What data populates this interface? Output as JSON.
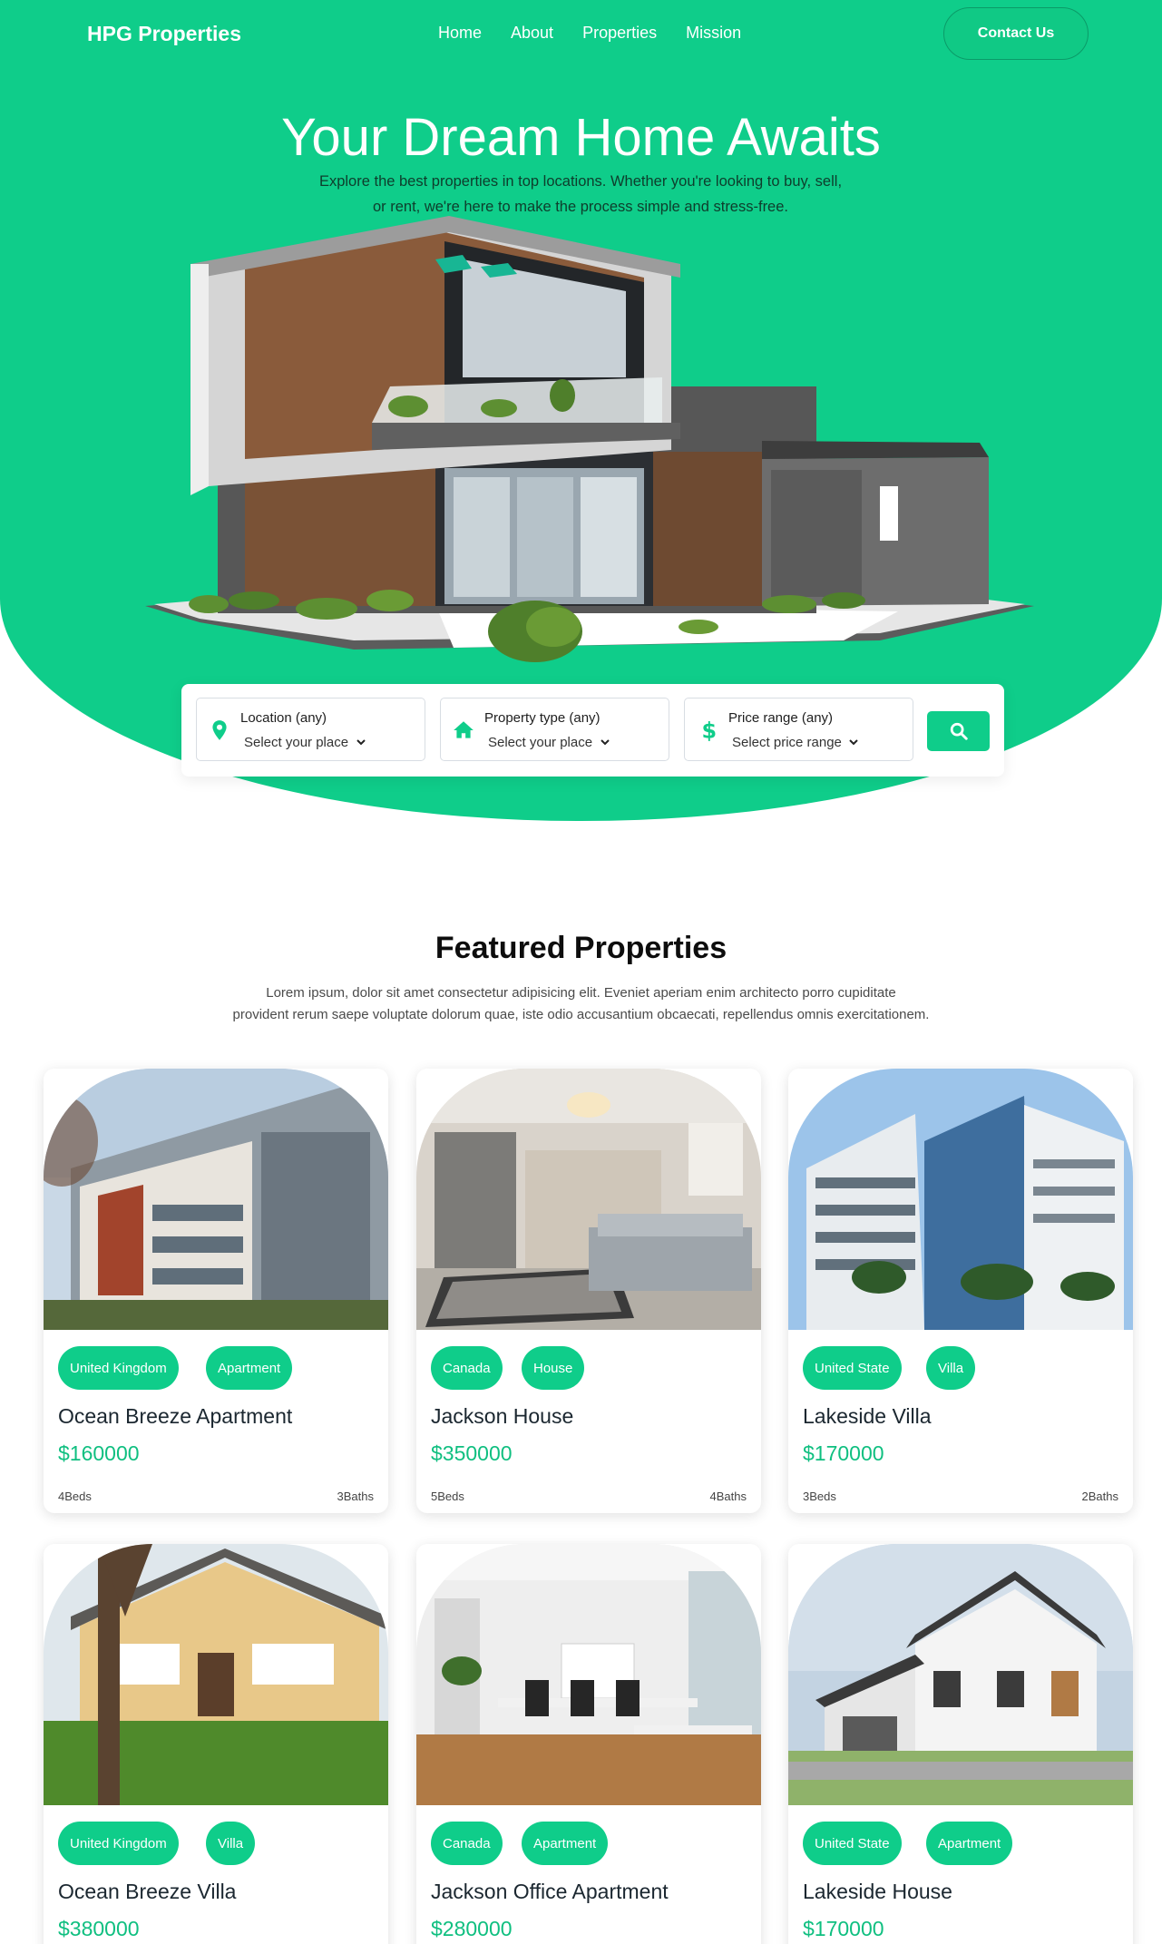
{
  "brand": "HPG Properties",
  "nav": {
    "items": [
      "Home",
      "About",
      "Properties",
      "Mission"
    ],
    "contact": "Contact Us"
  },
  "hero": {
    "title": "Your Dream Home Awaits",
    "subtitle_line1": "Explore the best properties in top locations. Whether you're looking to buy, sell,",
    "subtitle_line2": "or rent, we're here to make the process simple and stress-free."
  },
  "search": {
    "location": {
      "label": "Location (any)",
      "value": "Select your place"
    },
    "type": {
      "label": "Property type (any)",
      "value": "Select your place"
    },
    "price": {
      "label": "Price range (any)",
      "value": "Select price range"
    }
  },
  "featured": {
    "title": "Featured Properties",
    "desc_line1": "Lorem ipsum, dolor sit amet consectetur adipisicing elit. Eveniet aperiam enim architecto porro cupiditate",
    "desc_line2": "provident rerum saepe voluptate dolorum quae, iste odio accusantium obcaecati, repellendus omnis exercitationem."
  },
  "properties": [
    {
      "country": "United Kingdom",
      "type": "Apartment",
      "name": "Ocean Breeze Apartment",
      "price": "$160000",
      "beds": "4Beds",
      "baths": "3Baths"
    },
    {
      "country": "Canada",
      "type": "House",
      "name": "Jackson House",
      "price": "$350000",
      "beds": "5Beds",
      "baths": "4Baths"
    },
    {
      "country": "United State",
      "type": "Villa",
      "name": "Lakeside Villa",
      "price": "$170000",
      "beds": "3Beds",
      "baths": "2Baths"
    },
    {
      "country": "United Kingdom",
      "type": "Villa",
      "name": "Ocean Breeze Villa",
      "price": "$380000",
      "beds": "",
      "baths": ""
    },
    {
      "country": "Canada",
      "type": "Apartment",
      "name": "Jackson Office Apartment",
      "price": "$280000",
      "beds": "",
      "baths": ""
    },
    {
      "country": "United State",
      "type": "Apartment",
      "name": "Lakeside House",
      "price": "$170000",
      "beds": "",
      "baths": ""
    }
  ],
  "colors": {
    "accent": "#0fcd8a",
    "price": "#0fbf80"
  }
}
